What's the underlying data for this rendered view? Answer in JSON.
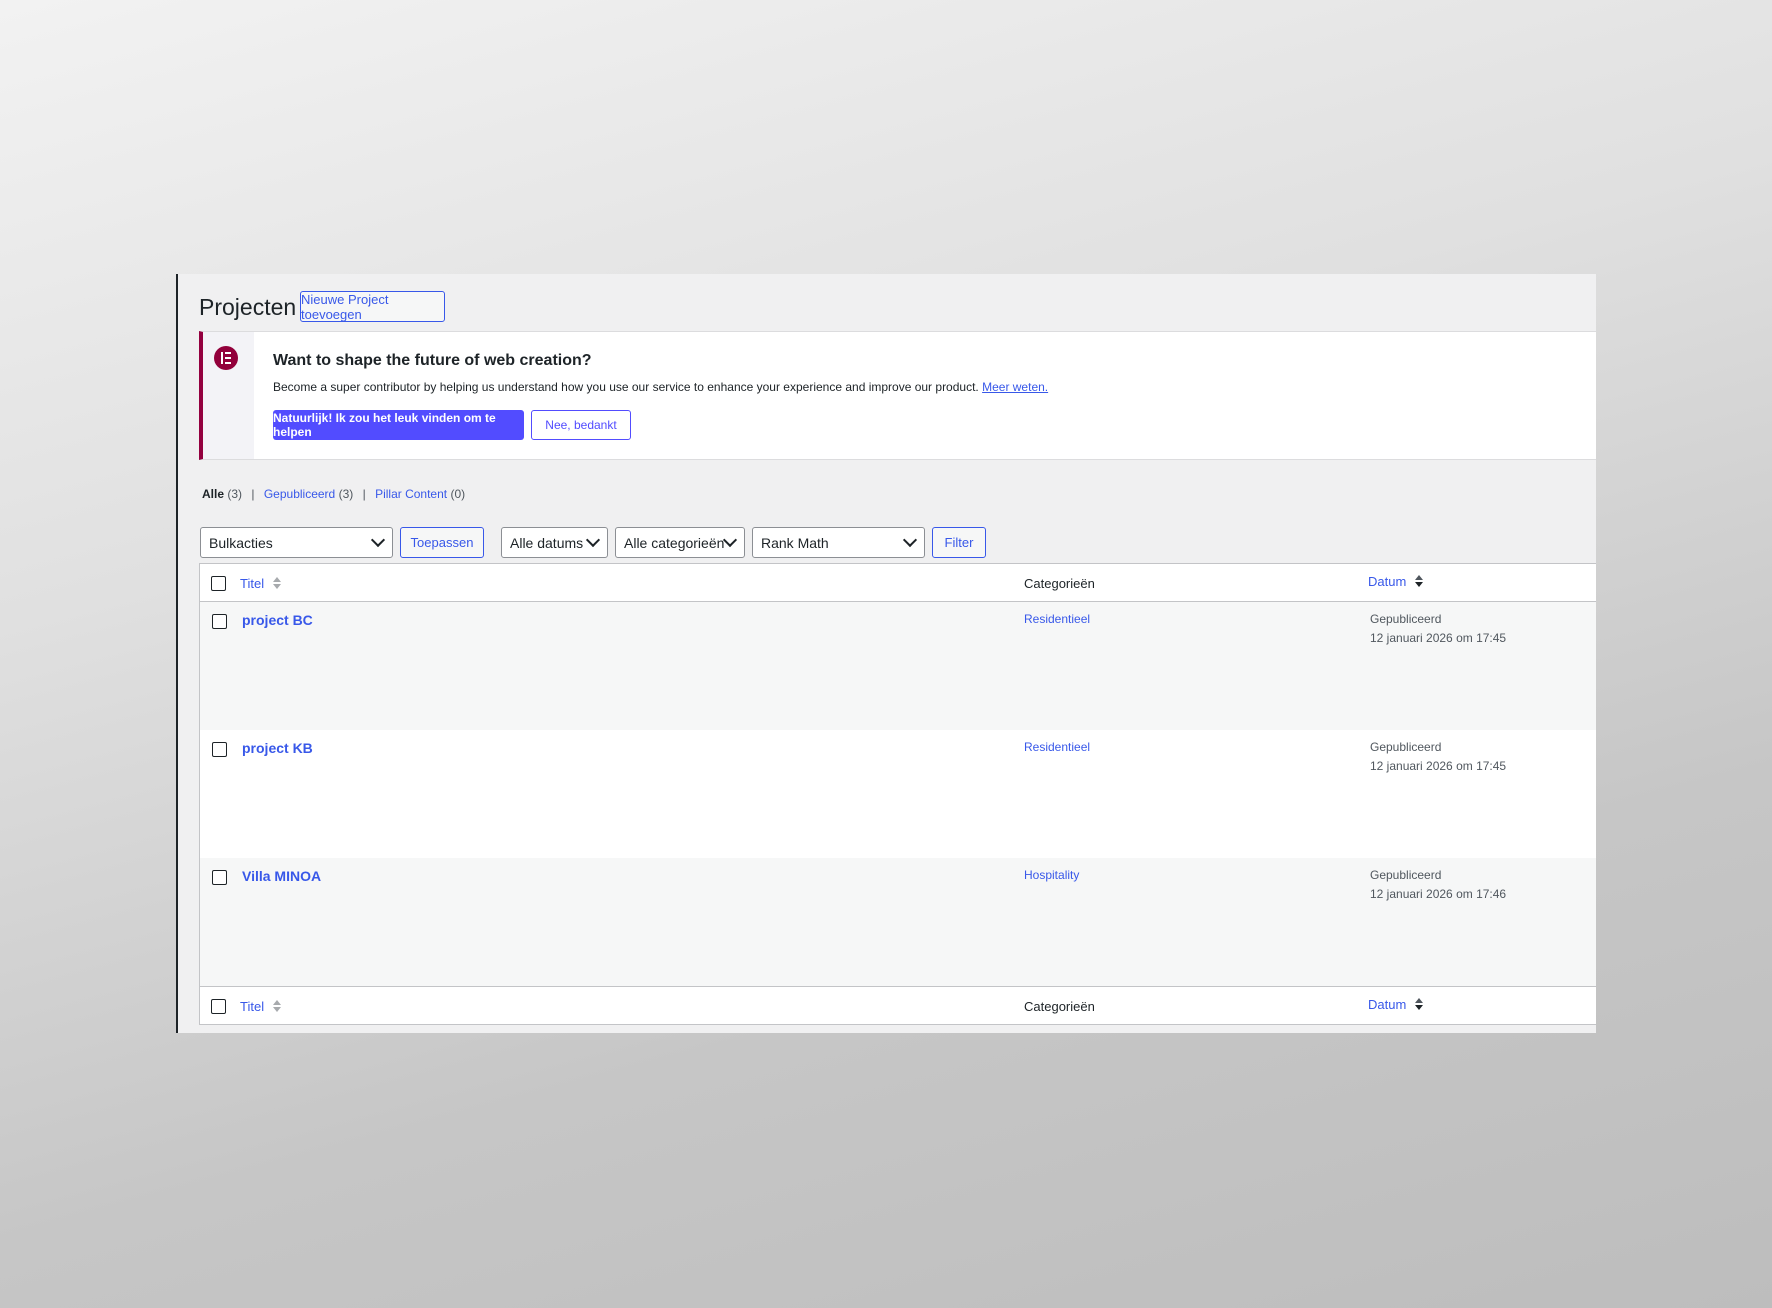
{
  "page": {
    "title": "Projecten",
    "add_new_label": "Nieuwe Project toevoegen"
  },
  "notice": {
    "title": "Want to shape the future of web creation?",
    "text": "Become a super contributor by helping us understand how you use our service to enhance your experience and improve our product.",
    "link": "Meer weten.",
    "accept_label": "Natuurlijk! Ik zou het leuk vinden om te helpen",
    "decline_label": "Nee, bedankt",
    "logo_icon": "elementor-icon",
    "accent_color": "#93003f"
  },
  "views": [
    {
      "label": "Alle",
      "count": "(3)"
    },
    {
      "label": "Gepubliceerd",
      "count": "(3)"
    },
    {
      "label": "Pillar Content",
      "count": "(0)"
    }
  ],
  "filters": {
    "bulk_actions": "Bulkacties",
    "apply_label": "Toepassen",
    "dates": "Alle datums",
    "categories": "Alle categorieën",
    "rank_math": "Rank Math",
    "filter_label": "Filter"
  },
  "table": {
    "columns": {
      "title": "Titel",
      "categories": "Categorieën",
      "date": "Datum"
    },
    "rows": [
      {
        "title": "project BC",
        "category": "Residentieel",
        "status": "Gepubliceerd",
        "date": "12 januari 2026 om 17:45"
      },
      {
        "title": "project KB",
        "category": "Residentieel",
        "status": "Gepubliceerd",
        "date": "12 januari 2026 om 17:45"
      },
      {
        "title": "Villa MINOA",
        "category": "Hospitality",
        "status": "Gepubliceerd",
        "date": "12 januari 2026 om 17:46"
      }
    ]
  },
  "colors": {
    "link": "#3858e9",
    "primary_button": "#524cff"
  }
}
